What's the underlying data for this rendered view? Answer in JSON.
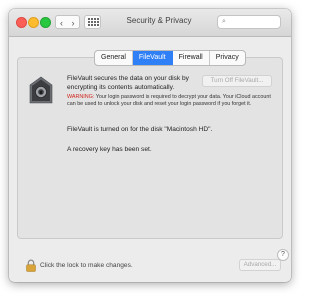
{
  "window": {
    "title": "Security & Privacy",
    "search_placeholder": ""
  },
  "icons": {
    "back": "‹",
    "forward": "›",
    "search": "⌕",
    "help": "?"
  },
  "tabs": [
    {
      "label": "General",
      "active": false
    },
    {
      "label": "FileVault",
      "active": true
    },
    {
      "label": "Firewall",
      "active": false
    },
    {
      "label": "Privacy",
      "active": false
    }
  ],
  "filevault": {
    "intro": "FileVault secures the data on your disk by encrypting its contents automatically.",
    "turn_off_label": "Turn Off FileVault...",
    "warning_label": "WARNING:",
    "warning_text": " Your login password is required to decrypt your data. Your iCloud account can be used to unlock your disk and reset your login password if you forget it.",
    "status": "FileVault is turned on for the disk \"Macintosh HD\".",
    "recovery": "A recovery key has been set."
  },
  "footer": {
    "lock_label": "Click the lock to make changes.",
    "advanced_label": "Advanced..."
  },
  "colors": {
    "accent": "#2f7ff7",
    "warning": "#d0241c"
  }
}
